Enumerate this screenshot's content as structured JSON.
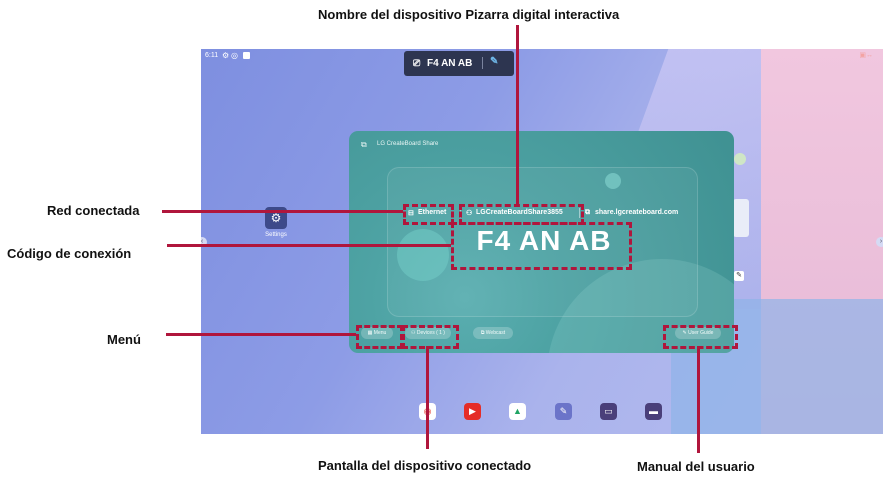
{
  "annotations": {
    "device_name": "Nombre del dispositivo Pizarra digital interactiva",
    "network": "Red conectada",
    "connection_code": "Código de conexión",
    "menu": "Menú",
    "connected_devices_screen": "Pantalla del dispositivo conectado",
    "user_manual": "Manual del usuario"
  },
  "status_bar": {
    "time": "6:11"
  },
  "top_bar": {
    "code": "F4 AN AB"
  },
  "desktop": {
    "settings_label": "Settings"
  },
  "share_panel": {
    "title": "LG CreateBoard Share",
    "ethernet": "Ethernet",
    "device_name": "LGCreateBoardShare3855",
    "url": "share.lgcreateboard.com",
    "code": "F4 AN AB",
    "menu_button": "Menu",
    "devices_button": "Devices ( 1 )",
    "webcast_button": "Webcast",
    "user_guide_button": "User Guide"
  },
  "colors": {
    "annotation": "#b0163c",
    "panel": "#4ea3a4",
    "top_bar": "#2d3550"
  }
}
